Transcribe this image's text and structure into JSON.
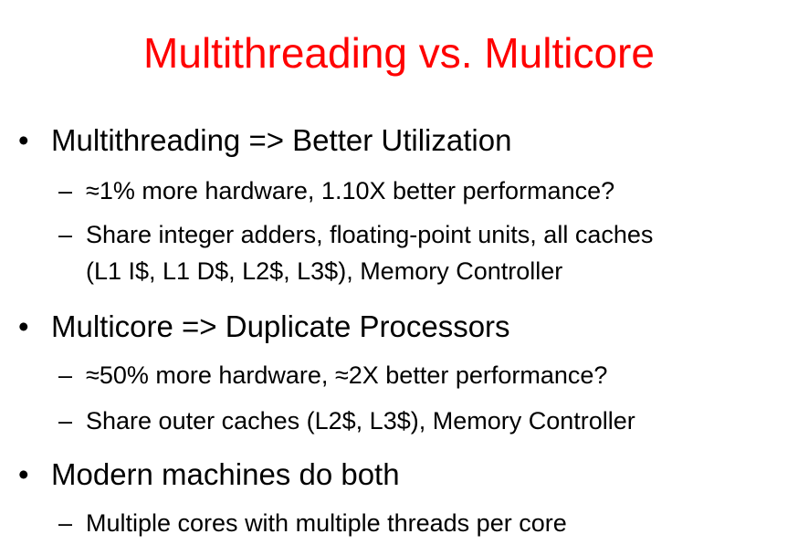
{
  "slide": {
    "title": "Multithreading vs. Multicore",
    "title_color": "#ff0000",
    "bullet_symbol": "•",
    "dash_symbol": "–",
    "points": [
      {
        "text": "Multithreading => Better Utilization",
        "subpoints": [
          {
            "line1": "≈1% more hardware, 1.10X better performance?"
          },
          {
            "line1": "Share integer adders, floating-point units, all caches",
            "line2": "(L1 I$, L1 D$, L2$, L3$), Memory Controller"
          }
        ]
      },
      {
        "text": "Multicore => Duplicate Processors",
        "subpoints": [
          {
            "line1": "≈50% more hardware, ≈2X better performance?"
          },
          {
            "line1": "Share outer caches (L2$, L3$), Memory Controller"
          }
        ]
      },
      {
        "text": "Modern machines do both",
        "subpoints": [
          {
            "line1": "Multiple cores with multiple threads per core"
          }
        ]
      }
    ]
  }
}
